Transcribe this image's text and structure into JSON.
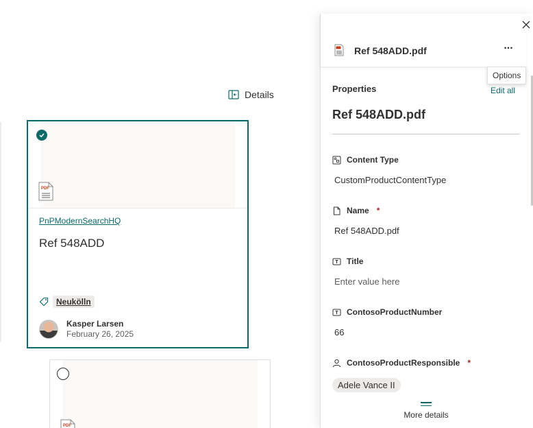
{
  "toolbar": {
    "details_label": "Details"
  },
  "cards": [
    {
      "selected": true,
      "file_type": "PDF",
      "site": "PnPModernSearchHQ",
      "title": "Ref 548ADD",
      "tag": "Neukölln",
      "author": "Kasper Larsen",
      "date": "February 26, 2025"
    },
    {
      "selected": false,
      "file_type": "PDF"
    }
  ],
  "panel": {
    "file_title": "Ref 548ADD.pdf",
    "more_label": "...",
    "tooltip": "Options",
    "properties_heading": "Properties",
    "edit_all": "Edit all",
    "file_heading": "Ref 548ADD.pdf",
    "fields": [
      {
        "label": "Content Type",
        "value": "CustomProductContentType",
        "icon": "content-type-icon",
        "required": false
      },
      {
        "label": "Name",
        "value": "Ref 548ADD.pdf",
        "icon": "document-icon",
        "required": true
      },
      {
        "label": "Title",
        "placeholder": "Enter value here",
        "icon": "text-field-icon",
        "required": false
      },
      {
        "label": "ContosoProductNumber",
        "value": "66",
        "icon": "text-field-icon",
        "required": false
      },
      {
        "label": "ContosoProductResponsible",
        "value": "Adele Vance II",
        "icon": "person-icon",
        "required": true
      }
    ],
    "required_mark": "*",
    "more_details": "More details"
  },
  "colors": {
    "accent": "#0b6a69",
    "required": "#a4262c",
    "tag_bg": "#edebe9"
  }
}
